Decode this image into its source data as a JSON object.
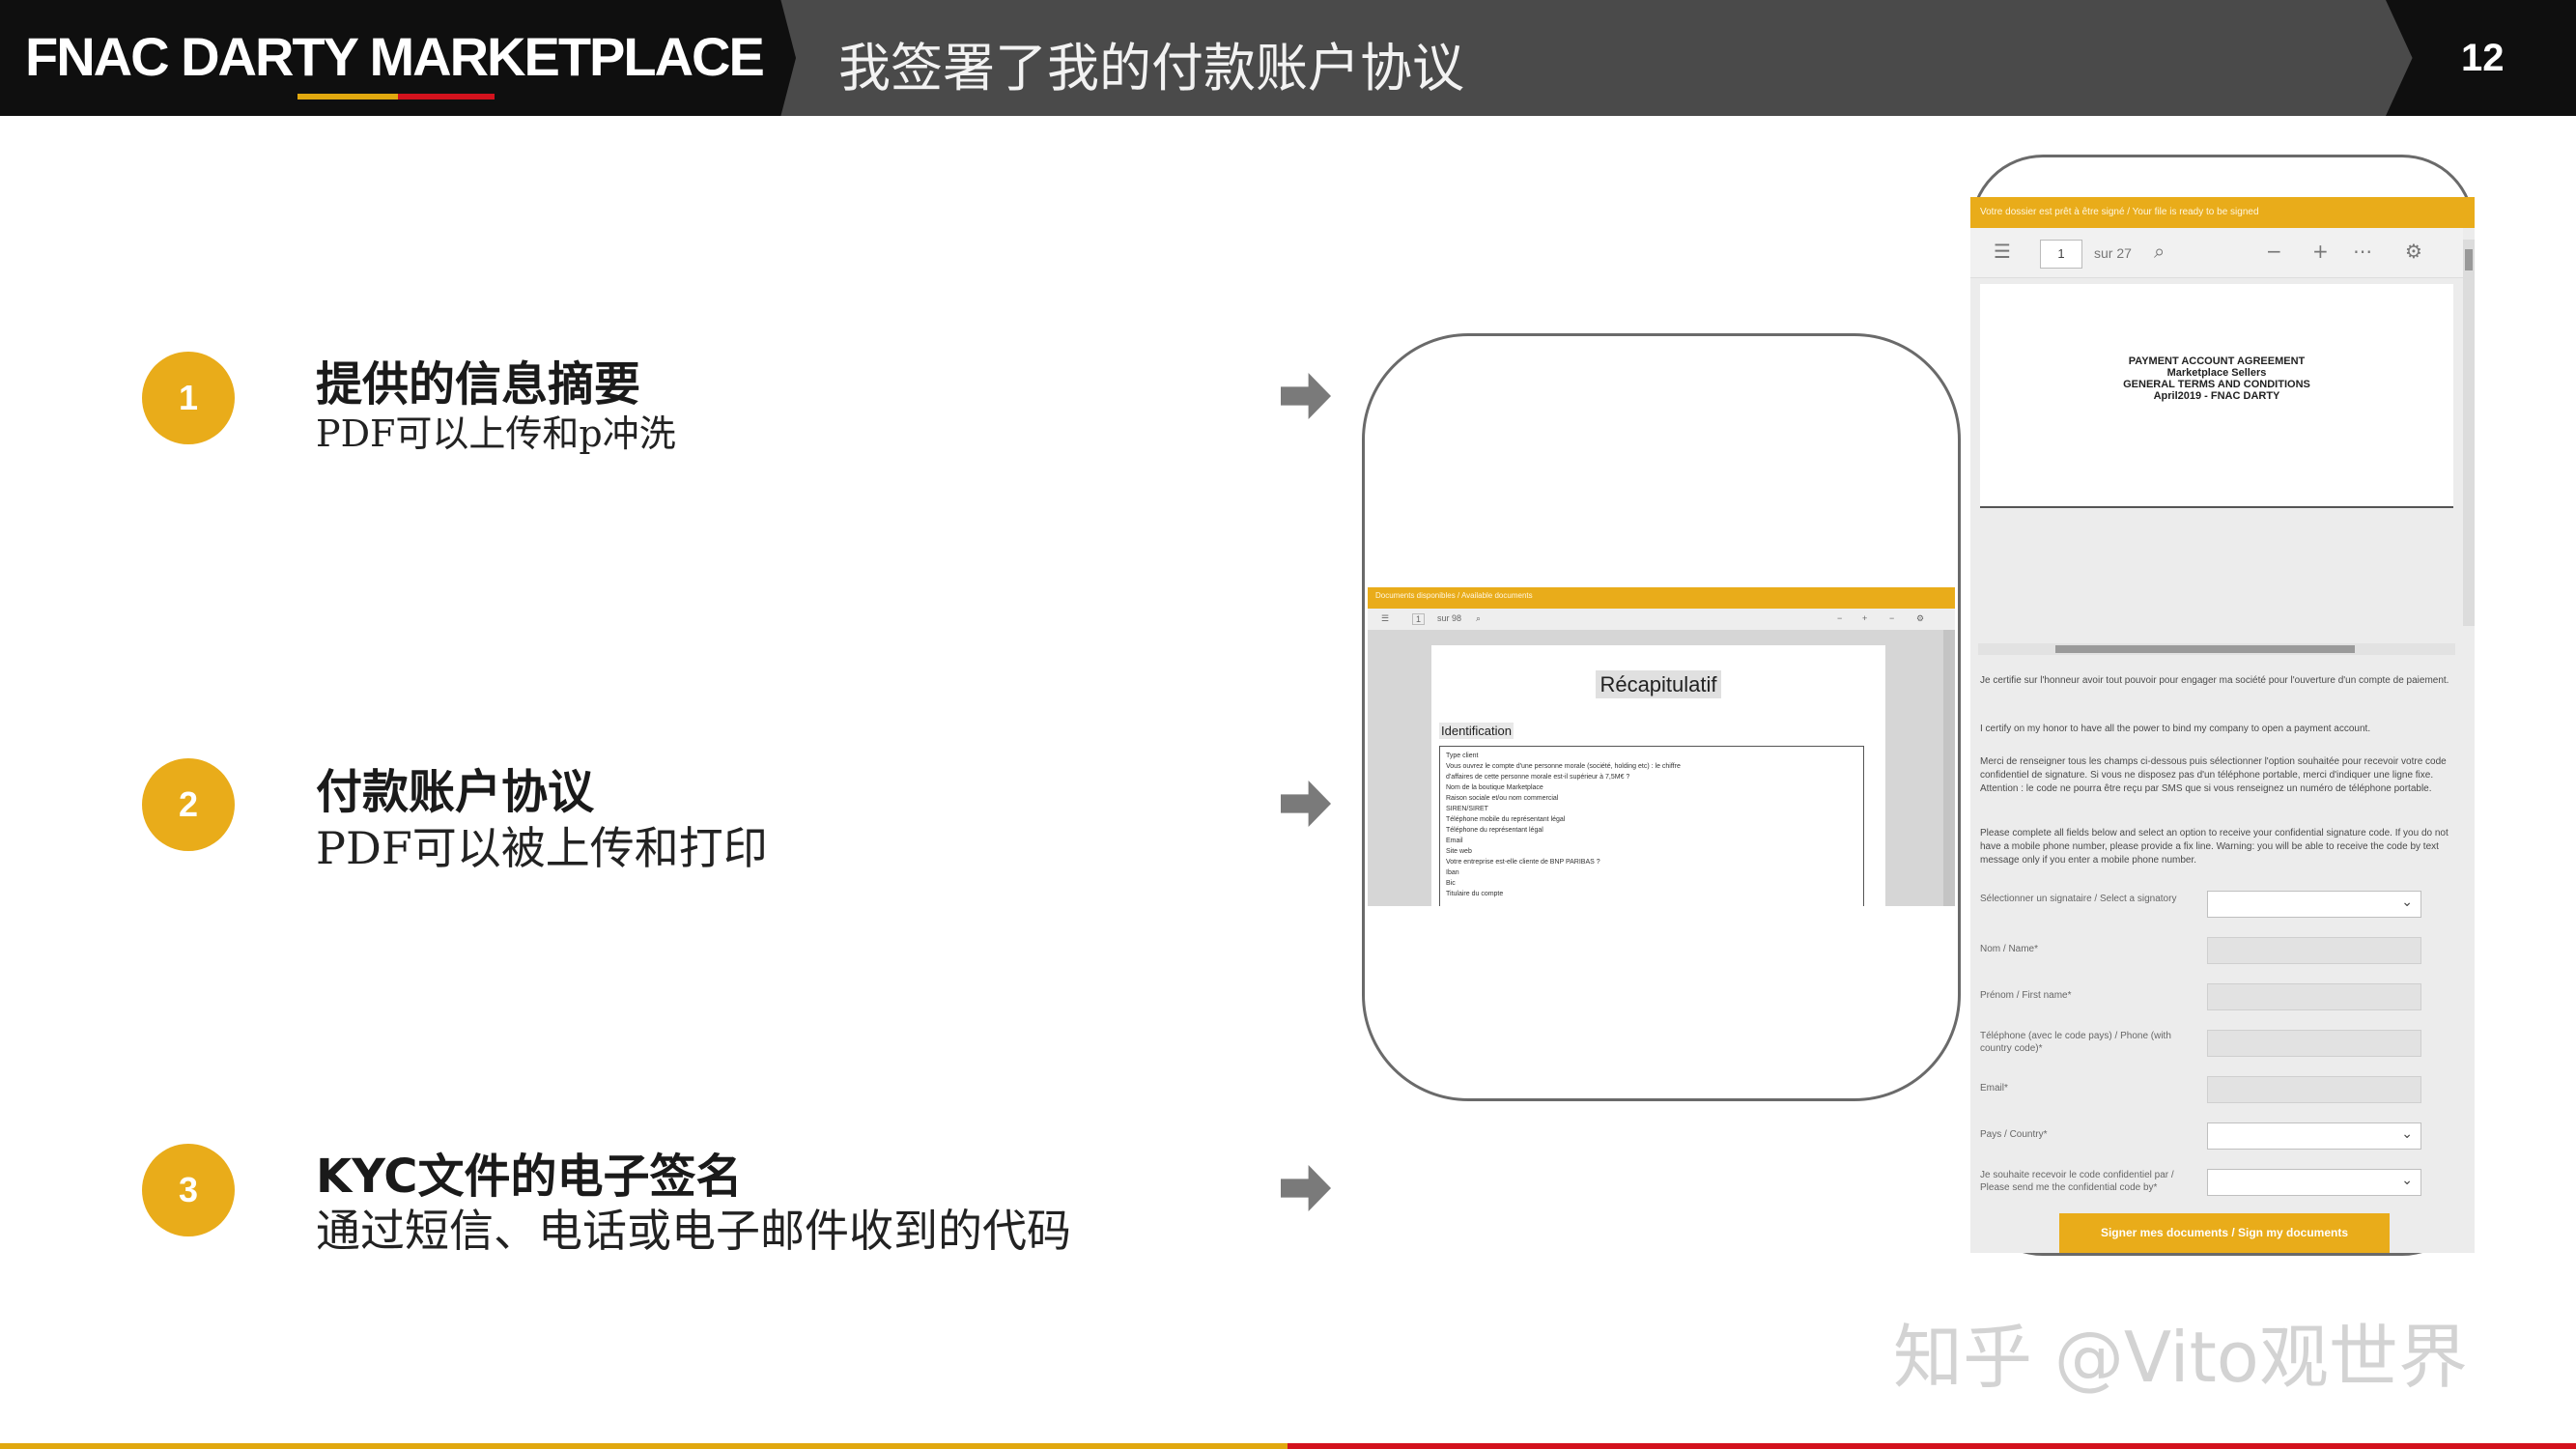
{
  "header": {
    "brand": "FNAC DARTY MARKETPLACE",
    "title": "我签署了我的付款账户协议",
    "page_number": "12"
  },
  "steps": [
    {
      "number": "1",
      "title": "提供的信息摘要",
      "description": "PDF可以上传和p冲洗"
    },
    {
      "number": "2",
      "title": "付款账户协议",
      "description": "PDF可以被上传和打印"
    },
    {
      "number": "3",
      "title": "KYC文件的电子签名",
      "description": "通过短信、电话或电子邮件收到的代码"
    }
  ],
  "recap_screen": {
    "banner": "Documents disponibles / Available documents",
    "page_count": "sur 98",
    "page_value": "1",
    "heading": "Récapitulatif",
    "section": "Identification",
    "rows": [
      "Type client",
      "Vous ouvrez le compte d'une personne morale (société, holding etc) : le chiffre",
      "d'affaires de cette personne morale est-il supérieur à 7,5M€ ?",
      "Nom de la boutique Marketplace",
      "Raison sociale et/ou nom commercial",
      "SIREN/SIRET",
      "Téléphone mobile du représentant légal",
      "Téléphone du représentant légal",
      "Email",
      "Site web",
      "Votre entreprise est-elle cliente de BNP PARIBAS ?",
      "Iban",
      "Bic",
      "Titulaire du compte"
    ]
  },
  "form_screen": {
    "banner": "Votre dossier est prêt à être signé / Your file is ready to be signed",
    "page_value": "1",
    "page_count": "sur 27",
    "doc_lines": [
      "PAYMENT ACCOUNT AGREEMENT",
      "Marketplace Sellers",
      "GENERAL TERMS AND CONDITIONS",
      "April2019 - FNAC DARTY"
    ],
    "paragraphs": [
      "Je certifie sur l'honneur avoir tout pouvoir pour engager ma société pour l'ouverture d'un compte de paiement.",
      "I certify on my honor to have all the power to bind my company to open a payment account.",
      "Merci de renseigner tous les champs ci-dessous puis sélectionner l'option souhaitée pour recevoir votre code confidentiel de signature. Si vous ne disposez pas d'un téléphone portable, merci d'indiquer une ligne fixe. Attention : le code ne pourra être reçu par SMS que si vous renseignez un numéro de téléphone portable.",
      "Please complete all fields below and select an option to receive your confidential signature code. If you do not have a mobile phone number, please provide a fix line. Warning: you will be able to receive the code by text message only if you enter a mobile phone number."
    ],
    "fields": [
      {
        "label": "Sélectionner un signataire / Select a signatory",
        "kind": "select"
      },
      {
        "label": "Nom / Name*",
        "kind": "input"
      },
      {
        "label": "Prénom / First name*",
        "kind": "input"
      },
      {
        "label": "Téléphone (avec le code pays) / Phone (with country code)*",
        "kind": "input"
      },
      {
        "label": "Email*",
        "kind": "input"
      },
      {
        "label": "Pays / Country*",
        "kind": "select"
      },
      {
        "label": "Je souhaite recevoir le code confidentiel par / Please send me the confidential code by*",
        "kind": "select"
      }
    ],
    "sign_button": "Signer mes documents / Sign my documents"
  },
  "watermark": "知乎 @Vito观世界",
  "colors": {
    "accent_yellow": "#e9ac1a",
    "accent_red": "#d3121d",
    "header_dark": "#0f0f0f",
    "header_gray": "#4a4a4a"
  },
  "icons": [
    "list-icon",
    "search-icon",
    "minus-icon",
    "plus-icon",
    "more-icon",
    "gear-icon",
    "chevron-down-icon",
    "arrow-right-icon"
  ]
}
